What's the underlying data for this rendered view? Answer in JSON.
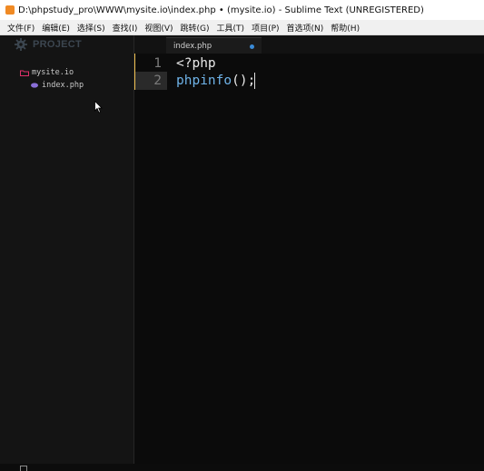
{
  "window": {
    "title": "D:\\phpstudy_pro\\WWW\\mysite.io\\index.php • (mysite.io) - Sublime Text (UNREGISTERED)"
  },
  "menu": {
    "items": [
      {
        "label": "文件(F)"
      },
      {
        "label": "编辑(E)"
      },
      {
        "label": "选择(S)"
      },
      {
        "label": "查找(I)"
      },
      {
        "label": "视图(V)"
      },
      {
        "label": "跳转(G)"
      },
      {
        "label": "工具(T)"
      },
      {
        "label": "项目(P)"
      },
      {
        "label": "首选项(N)"
      },
      {
        "label": "帮助(H)"
      }
    ]
  },
  "sidebar": {
    "header": "PROJECT",
    "tree": [
      {
        "type": "folder",
        "label": "mysite.io"
      },
      {
        "type": "file",
        "label": "index.php"
      }
    ]
  },
  "tabs": [
    {
      "label": "index.php",
      "dirty": true
    }
  ],
  "editor": {
    "lines": [
      {
        "number": "1",
        "tokens": [
          {
            "text": "<?php",
            "kind": "tag"
          }
        ]
      },
      {
        "number": "2",
        "tokens": [
          {
            "text": "phpinfo",
            "kind": "fn"
          },
          {
            "text": "();",
            "kind": "punc"
          }
        ]
      }
    ]
  },
  "colors": {
    "accent": "#f0c050",
    "function": "#6fb3e8",
    "folder": "#e0306a",
    "file": "#8a6fd8"
  },
  "icons": {
    "sidebar_header": "gear-icon",
    "folder": "folder-icon",
    "file": "php-file-icon",
    "cursor": "mouse-pointer-icon"
  }
}
